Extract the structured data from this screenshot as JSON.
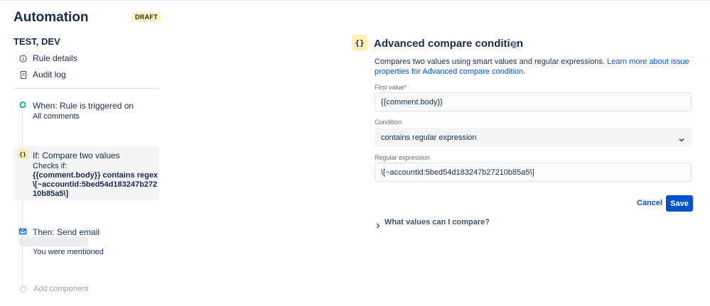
{
  "app": {
    "title": "Automation",
    "status_badge": "DRAFT"
  },
  "sidebar": {
    "project": "TEST, DEV",
    "nav": [
      {
        "label": "Rule details",
        "icon": "info-icon"
      },
      {
        "label": "Audit log",
        "icon": "document-icon"
      }
    ],
    "steps": {
      "trigger": {
        "title": "When: Rule is triggered on",
        "subtitle": "All comments",
        "icon": "comment-icon",
        "color": "#e3fcef"
      },
      "condition": {
        "title": "If: Compare two values",
        "checks_label": "Checks if:",
        "detail": "{{comment.body}} contains regex \\[~accountid:5bed54d183247b27210b85a5\\]",
        "icon": "braces-icon",
        "color": "#fff0b3"
      },
      "action": {
        "title": "Then: Send email",
        "subtitle": "You were mentioned",
        "icon": "mail-icon",
        "color": "#deebff"
      }
    },
    "add_component": "Add component"
  },
  "panel": {
    "icon_text": "{}",
    "title": "Advanced compare condition",
    "description": "Compares two values using smart values and regular expressions.",
    "learn_more": "Learn more about issue properties for Advanced compare condition.",
    "first_value_label": "First value",
    "required_marker": "*",
    "first_value": "{{comment.body}}",
    "condition_label": "Condition",
    "condition_value": "contains regular expression",
    "regex_label": "Regular expression",
    "regex_value": "\\[~accountid:5bed54d183247b27210b85a5\\]",
    "cancel_label": "Cancel",
    "save_label": "Save",
    "help_expander": "What values can I compare?"
  },
  "colors": {
    "accent": "#0052cc",
    "text": "#172b4d",
    "muted": "#5e6c84"
  }
}
